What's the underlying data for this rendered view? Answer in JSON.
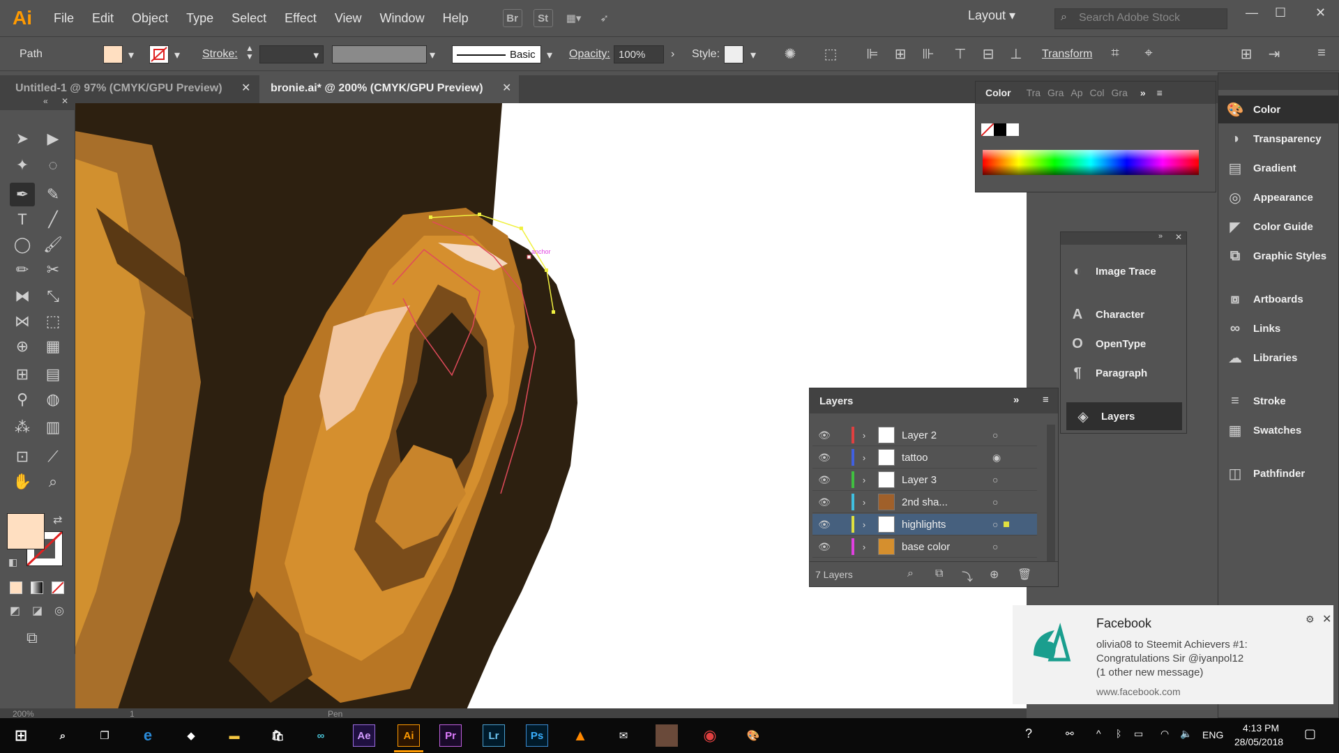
{
  "app": {
    "logo": "Ai"
  },
  "menu": [
    "File",
    "Edit",
    "Object",
    "Type",
    "Select",
    "Effect",
    "View",
    "Window",
    "Help"
  ],
  "menubar_buttons": {
    "bridge": "Br",
    "stock": "St"
  },
  "workspace": {
    "label": "Layout",
    "search_placeholder": "Search Adobe Stock"
  },
  "controlbar": {
    "selection_type": "Path",
    "stroke_label": "Stroke:",
    "brush_label": "Basic",
    "opacity_label": "Opacity:",
    "opacity_value": "100%",
    "style_label": "Style:",
    "transform_label": "Transform",
    "fill_color": "#ffdfc1"
  },
  "tabs": [
    {
      "label": "Untitled-1 @ 97% (CMYK/GPU Preview)",
      "active": false
    },
    {
      "label": "bronie.ai* @ 200% (CMYK/GPU Preview)",
      "active": true
    }
  ],
  "color_panel": {
    "title": "Color",
    "tabs": [
      "Tra",
      "Gra",
      "Ap",
      "Col",
      "Gra"
    ]
  },
  "floating_panel": {
    "items": [
      "Image Trace",
      "Character",
      "OpenType",
      "Paragraph",
      "Layers"
    ]
  },
  "layers_panel": {
    "title": "Layers",
    "footer": "7 Layers",
    "rows": [
      {
        "name": "Layer 2",
        "color": "#e04040"
      },
      {
        "name": "tattoo",
        "color": "#4060e0"
      },
      {
        "name": "Layer 3",
        "color": "#40c040"
      },
      {
        "name": "2nd sha...",
        "color": "#40c0e0"
      },
      {
        "name": "highlights",
        "color": "#e0e040",
        "selected": true
      },
      {
        "name": "base color",
        "color": "#e040e0"
      }
    ]
  },
  "dock": {
    "items": [
      "Color",
      "Transparency",
      "Gradient",
      "Appearance",
      "Color Guide",
      "Graphic Styles",
      "Artboards",
      "Links",
      "Libraries",
      "Stroke",
      "Swatches",
      "Pathfinder"
    ]
  },
  "canvas": {
    "anchor_label": "anchor"
  },
  "statusbar": {
    "zoom": "200%",
    "artboard": "1",
    "tool": "Pen"
  },
  "toast": {
    "app": "Facebook",
    "line1": "olivia08 to Steemit Achievers #1:",
    "line2": "Congratulations Sir @iyanpol12",
    "line3": "(1 other new message)",
    "source": "www.facebook.com"
  },
  "taskbar": {
    "apps": [
      "Ae",
      "Ai",
      "Pr",
      "Lr",
      "Ps"
    ],
    "language": "ENG",
    "time": "4:13 PM",
    "date": "28/05/2018"
  }
}
